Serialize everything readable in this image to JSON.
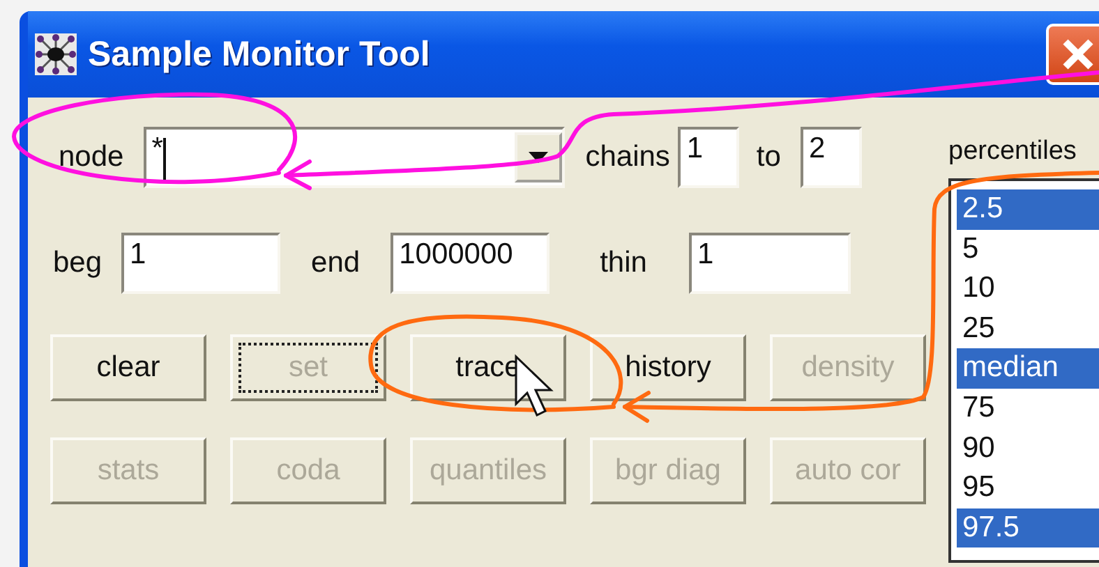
{
  "window": {
    "title": "Sample Monitor Tool"
  },
  "node": {
    "label": "node",
    "value": "*"
  },
  "chains": {
    "label": "chains",
    "from": "1",
    "to_label": "to",
    "to": "2"
  },
  "range": [
    {
      "label": "beg",
      "value": "1"
    },
    {
      "label": "end",
      "value": "1000000"
    },
    {
      "label": "thin",
      "value": "1"
    }
  ],
  "button_rows": [
    [
      {
        "label": "clear",
        "disabled": false,
        "focused": false
      },
      {
        "label": "set",
        "disabled": true,
        "focused": true
      },
      {
        "label": "trace",
        "disabled": false,
        "focused": false
      },
      {
        "label": "history",
        "disabled": false,
        "focused": false
      },
      {
        "label": "density",
        "disabled": true,
        "focused": false
      }
    ],
    [
      {
        "label": "stats",
        "disabled": true,
        "focused": false
      },
      {
        "label": "coda",
        "disabled": true,
        "focused": false
      },
      {
        "label": "quantiles",
        "disabled": true,
        "focused": false
      },
      {
        "label": "bgr diag",
        "disabled": true,
        "focused": false
      },
      {
        "label": "auto cor",
        "disabled": true,
        "focused": false
      }
    ]
  ],
  "percentiles": {
    "label": "percentiles",
    "items": [
      {
        "label": "2.5",
        "selected": true
      },
      {
        "label": "5",
        "selected": false
      },
      {
        "label": "10",
        "selected": false
      },
      {
        "label": "25",
        "selected": false
      },
      {
        "label": "median",
        "selected": true
      },
      {
        "label": "75",
        "selected": false
      },
      {
        "label": "90",
        "selected": false
      },
      {
        "label": "95",
        "selected": false
      },
      {
        "label": "97.5",
        "selected": true
      }
    ]
  }
}
